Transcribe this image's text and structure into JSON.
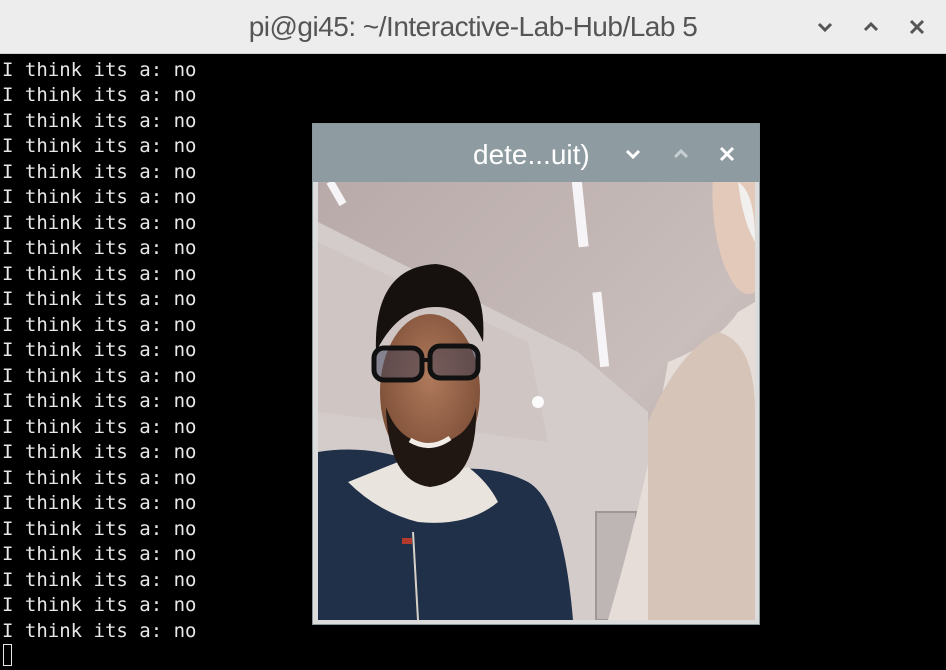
{
  "window": {
    "title": "pi@gi45: ~/Interactive-Lab-Hub/Lab 5",
    "icons": [
      "chevron-down-icon",
      "chevron-up-icon",
      "close-icon"
    ]
  },
  "terminal": {
    "lines": [
      "I think its a: no",
      "I think its a: no",
      "I think its a: no",
      "I think its a: no",
      "I think its a: no",
      "I think its a: no",
      "I think its a: no",
      "I think its a: no",
      "I think its a: no",
      "I think its a: no",
      "I think its a: no",
      "I think its a: no",
      "I think its a: no",
      "I think its a: no",
      "I think its a: no",
      "I think its a: no",
      "I think its a: no",
      "I think its a: no",
      "I think its a: no",
      "I think its a: no",
      "I think its a: no",
      "I think its a: no",
      "I think its a: no"
    ]
  },
  "popup": {
    "title": "dete...uit)",
    "colors": {
      "titlebar": "#8e9ba1",
      "title_text": "#ffffff"
    }
  },
  "colors": {
    "terminal_bg": "#000000",
    "terminal_fg": "#e8e8e8",
    "titlebar_bg": "#ededed"
  }
}
